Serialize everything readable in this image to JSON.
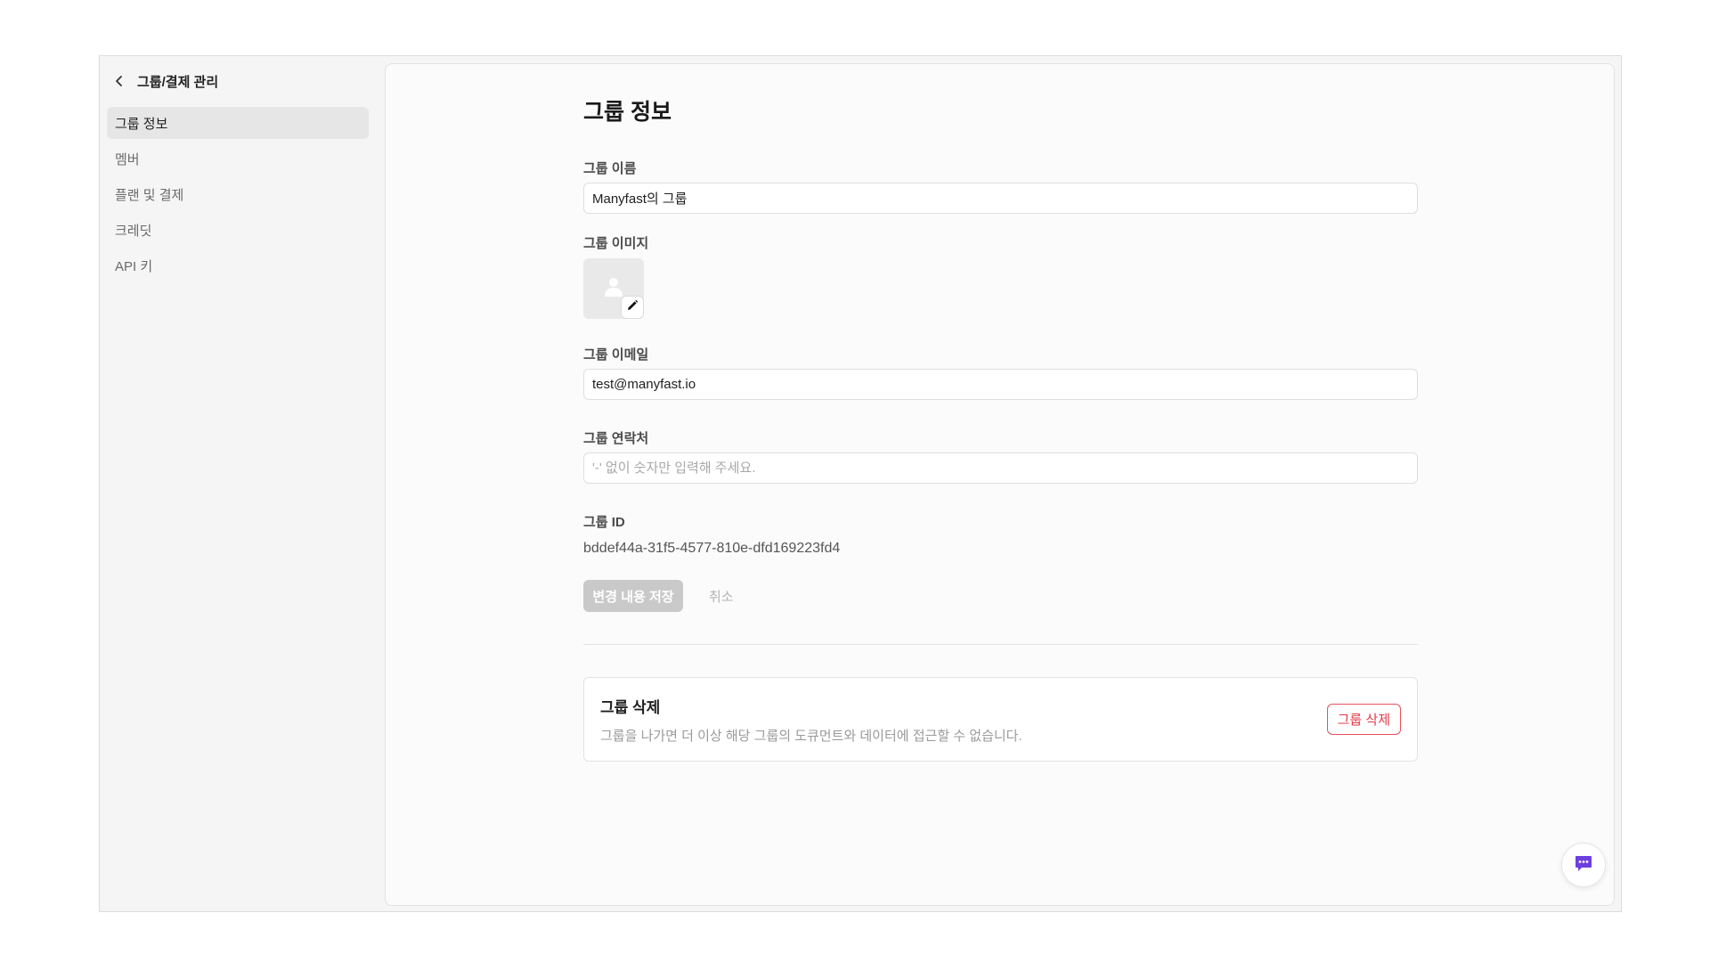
{
  "sidebar": {
    "title": "그룹/결제 관리",
    "items": [
      {
        "label": "그룹 정보",
        "active": true
      },
      {
        "label": "멤버",
        "active": false
      },
      {
        "label": "플랜 및 결제",
        "active": false
      },
      {
        "label": "크레딧",
        "active": false
      },
      {
        "label": "API 키",
        "active": false
      }
    ]
  },
  "main": {
    "title": "그룹 정보",
    "group_name": {
      "label": "그룹 이름",
      "value": "Manyfast의 그룹"
    },
    "group_image": {
      "label": "그룹 이미지",
      "icon": "person-icon",
      "edit_icon": "pencil-icon"
    },
    "group_email": {
      "label": "그룹 이메일",
      "value": "test@manyfast.io"
    },
    "group_contact": {
      "label": "그룹 연락처",
      "value": "",
      "placeholder": "'-' 없이 숫자만 입력해 주세요."
    },
    "group_id": {
      "label": "그룹 ID",
      "value": "bddef44a-31f5-4577-810e-dfd169223fd4"
    },
    "actions": {
      "save_label": "변경 내용 저장",
      "cancel_label": "취소"
    },
    "delete_section": {
      "title": "그룹 삭제",
      "description": "그룹을 나가면 더 이상 해당 그룹의 도큐먼트와 데이터에 접근할 수 없습니다.",
      "button_label": "그룹 삭제"
    }
  },
  "chat_widget": {
    "icon": "chat-bubble-icon",
    "color": "#6c3fe0"
  },
  "colors": {
    "danger": "#e23b48",
    "disabled_button": "#c9c9c9",
    "active_nav_bg": "#e6e6e6"
  }
}
